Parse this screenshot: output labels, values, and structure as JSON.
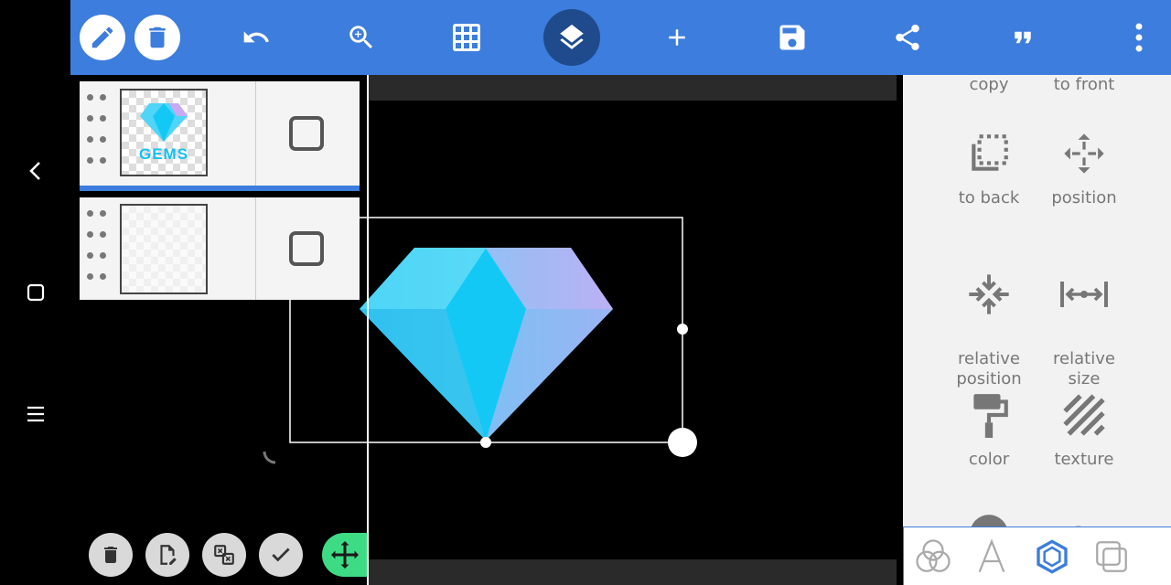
{
  "toolbar": {
    "icons": [
      "pencil-icon",
      "trash-icon",
      "undo-icon",
      "zoom-in-icon",
      "grid-icon",
      "layers-icon",
      "plus-icon",
      "save-icon",
      "share-icon",
      "quote-icon",
      "more-vert-icon"
    ],
    "accent": "#3c7ddd"
  },
  "system_nav": {
    "icons": [
      "back-icon",
      "home-square-icon",
      "menu-icon"
    ]
  },
  "layers": [
    {
      "thumb_label": "GEMS",
      "selected": true
    },
    {
      "thumb_label": "",
      "selected": false
    }
  ],
  "tools": {
    "copy": "copy",
    "to_front": "to front",
    "to_back": "to back",
    "position": "position",
    "relative_position": "relative\nposition",
    "relative_size": "relative\nsize",
    "color": "color",
    "texture": "texture"
  },
  "bottom_tabs": [
    "blend-icon",
    "text-icon",
    "shape-icon",
    "duplicate-icon"
  ],
  "bottom_actions": [
    "delete-icon",
    "edit-file-icon",
    "flip-icon",
    "check-icon",
    "move-icon"
  ]
}
